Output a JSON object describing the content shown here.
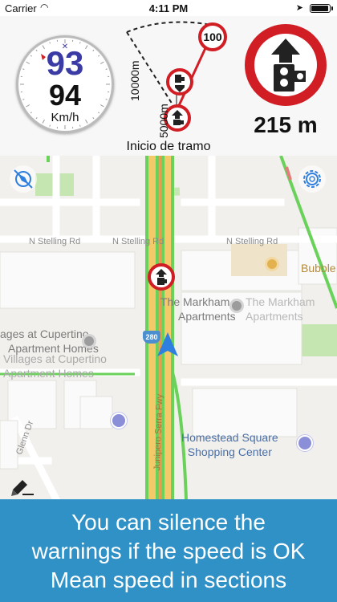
{
  "status_bar": {
    "carrier": "Carrier",
    "time": "4:11 PM",
    "battery_level": 1.0
  },
  "speedometer": {
    "speed_limit": "93",
    "current_speed": "94",
    "unit": "Km/h"
  },
  "section_diagram": {
    "distance_far": "10000m",
    "distance_near": "5000m",
    "limit_sign_value": "100",
    "caption": "Inicio de tramo"
  },
  "warning": {
    "distance": "215 m"
  },
  "map": {
    "street_labels": [
      "N Stelling Rd",
      "N Stelling Rd",
      "N Stelling Rd"
    ],
    "highway_number": "280",
    "highway_name": "Junipero Serra Fwy",
    "side_street": "Glenn Dr",
    "pois": [
      {
        "name_line1": "The Markham",
        "name_line2": "Apartments"
      },
      {
        "name_line1": "The Markham",
        "name_line2": "Apartments"
      },
      {
        "name_line1": "Bubble T"
      },
      {
        "name_line1": "ages at Cupertino",
        "name_line2": "Apartment Homes"
      },
      {
        "name_line1": "Villages at Cupertino",
        "name_line2": "Apartment Homes"
      },
      {
        "name_line1": "Homestead Square",
        "name_line2": "Shopping Center"
      }
    ]
  },
  "banner": {
    "line1": "You can silence the",
    "line2": "warnings if the speed is OK",
    "line3": "Mean speed in sections"
  },
  "colors": {
    "sign_red": "#d01e24",
    "limit_blue": "#3b3ba5",
    "banner_blue": "#2f91c6",
    "highway_yellow": "#f4c96a",
    "traffic_green": "#6ad25a"
  },
  "icons": [
    "wifi-icon",
    "location-arrow-icon",
    "battery-icon",
    "compass-icon",
    "gear-icon",
    "speed-camera-icon",
    "user-location-icon",
    "pen-icon",
    "shopping-bag-icon"
  ]
}
